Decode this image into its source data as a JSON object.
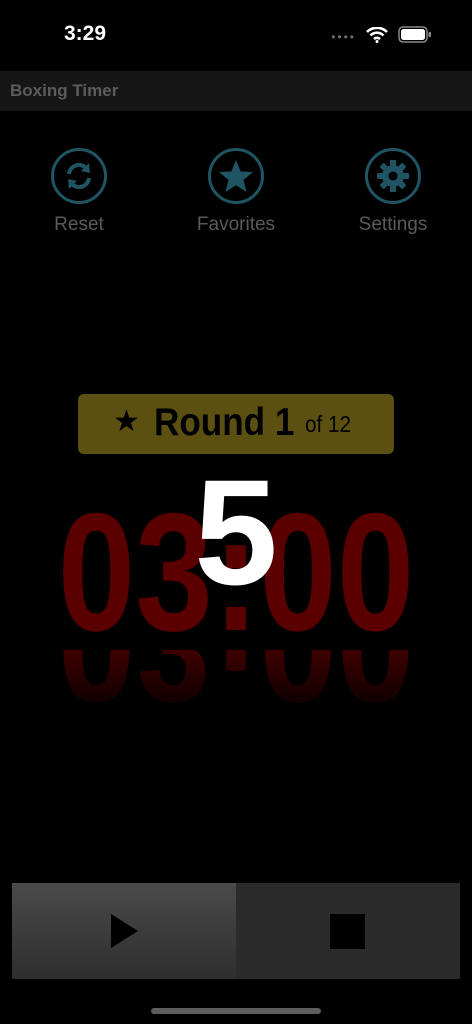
{
  "status_bar": {
    "time": "3:29",
    "signal_dots": "••••"
  },
  "title_bar": {
    "title": "Boxing Timer"
  },
  "toolbar": {
    "reset_label": "Reset",
    "favorites_label": "Favorites",
    "settings_label": "Settings"
  },
  "round": {
    "star": "★",
    "label": "Round 1",
    "of_label": "of 12"
  },
  "timer": {
    "time": "03:00"
  },
  "countdown": {
    "value": "5"
  },
  "icons": [
    "reset-icon",
    "star-icon",
    "gear-icon",
    "play-icon",
    "stop-icon",
    "wifi-icon",
    "battery-icon"
  ],
  "colors": {
    "accent_icon": "#1f5462",
    "badge": "#5b5012",
    "timer_red": "#5a0000"
  }
}
